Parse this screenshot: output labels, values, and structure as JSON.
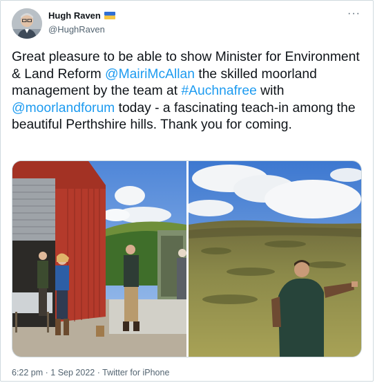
{
  "author": {
    "name": "Hugh Raven",
    "handle": "@HughRaven",
    "flag_icon": "ukraine-flag-icon",
    "avatar_icon": "profile-photo"
  },
  "more_label": "···",
  "tweet": {
    "text_1": "Great pleasure to be able to show Minister for Environment & Land Reform ",
    "mention_1": "@MairiMcAllan",
    "text_2": " the skilled moorland management by the team at ",
    "hashtag_1": "#Auchnafree",
    "text_3": " with ",
    "mention_2": "@moorlandforum",
    "text_4": " today - a fascinating teach-in among the beautiful Perthshire hills. Thank you for coming."
  },
  "media": {
    "photos": [
      "photo-farm-shed-group",
      "photo-moorland-hillside"
    ]
  },
  "footer": {
    "time": "6:22 pm",
    "sep1": " · ",
    "date": "1 Sep 2022",
    "sep2": " · ",
    "source": "Twitter for iPhone"
  },
  "colors": {
    "link": "#1d9bf0",
    "text": "#0f1419",
    "secondary": "#536471"
  }
}
